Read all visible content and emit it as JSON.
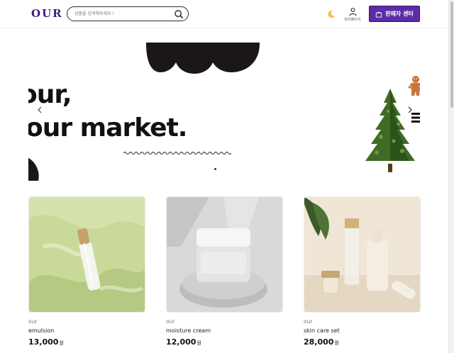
{
  "header": {
    "logo": "OUR",
    "search_placeholder": "상품을 검색해보세요 !",
    "mypage_label": "마이페이지",
    "seller_button": "판매자 센터"
  },
  "banner": {
    "line1": "our,",
    "line2": "our market."
  },
  "products": [
    {
      "brand": "our",
      "name": "emulsion",
      "price": "13,000",
      "currency": "원"
    },
    {
      "brand": "our",
      "name": "moisture cream",
      "price": "12,000",
      "currency": "원"
    },
    {
      "brand": "our",
      "name": "skin care set",
      "price": "28,000",
      "currency": "원"
    }
  ],
  "colors": {
    "brand": "#3d1c7a",
    "seller_button": "#5a2ea6"
  }
}
